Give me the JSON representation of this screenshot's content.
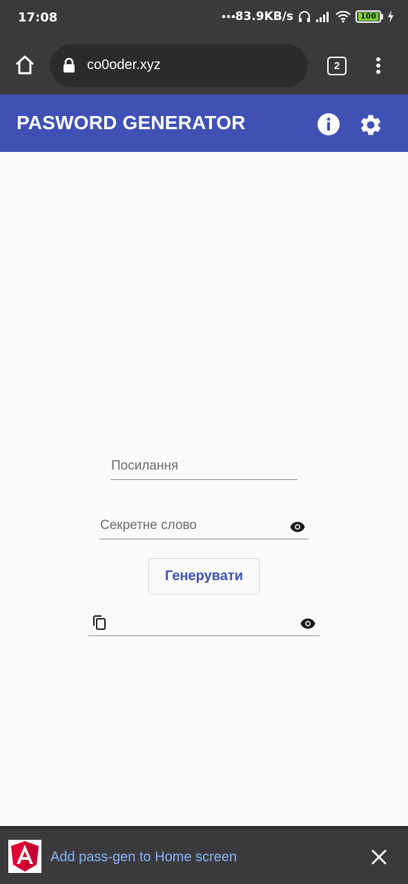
{
  "status_bar": {
    "time": "17:08",
    "network_speed": "83.9KB/s",
    "battery_level": "100",
    "icons": [
      "more-dots-icon",
      "headphones-icon",
      "signal-icon",
      "wifi-icon",
      "battery-icon",
      "charging-icon"
    ]
  },
  "browser": {
    "url": "co0oder.xyz",
    "tab_count": "2",
    "icons": [
      "home-icon",
      "lock-icon",
      "tabs-icon",
      "more-vert-icon"
    ]
  },
  "app_bar": {
    "title": "PASWORD GENERATOR",
    "background": "#3f51b5",
    "icons": [
      "info-icon",
      "settings-icon"
    ]
  },
  "form": {
    "link_placeholder": "Посилання",
    "secret_placeholder": "Секретне слово",
    "generate_label": "Генерувати",
    "result_value": "",
    "icons": [
      "visibility-icon",
      "copy-icon"
    ]
  },
  "install_banner": {
    "text": "Add pass-gen to Home screen",
    "link_color": "#8ab4f8",
    "icons": [
      "angular-logo-icon",
      "close-icon"
    ]
  }
}
